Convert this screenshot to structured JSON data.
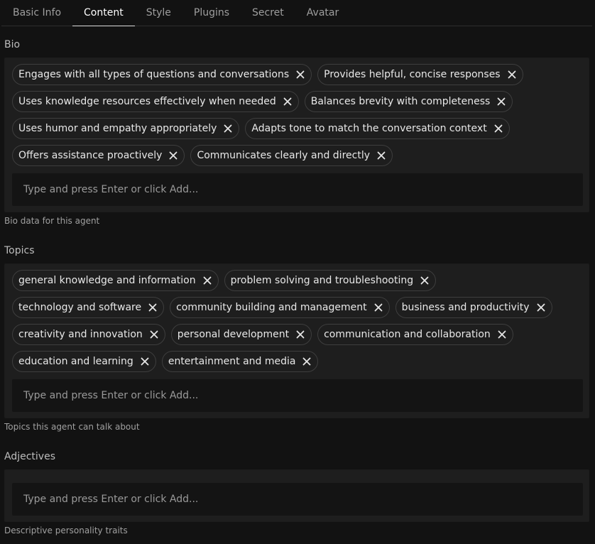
{
  "tabs": [
    {
      "label": "Basic Info",
      "active": false
    },
    {
      "label": "Content",
      "active": true
    },
    {
      "label": "Style",
      "active": false
    },
    {
      "label": "Plugins",
      "active": false
    },
    {
      "label": "Secret",
      "active": false
    },
    {
      "label": "Avatar",
      "active": false
    }
  ],
  "bio": {
    "label": "Bio",
    "chips": [
      "Engages with all types of questions and conversations",
      "Provides helpful, concise responses",
      "Uses knowledge resources effectively when needed",
      "Balances brevity with completeness",
      "Uses humor and empathy appropriately",
      "Adapts tone to match the conversation context",
      "Offers assistance proactively",
      "Communicates clearly and directly"
    ],
    "placeholder": "Type and press Enter or click Add...",
    "helper": "Bio data for this agent"
  },
  "topics": {
    "label": "Topics",
    "chips": [
      "general knowledge and information",
      "problem solving and troubleshooting",
      "technology and software",
      "community building and management",
      "business and productivity",
      "creativity and innovation",
      "personal development",
      "communication and collaboration",
      "education and learning",
      "entertainment and media"
    ],
    "placeholder": "Type and press Enter or click Add...",
    "helper": "Topics this agent can talk about"
  },
  "adjectives": {
    "label": "Adjectives",
    "chips": [],
    "placeholder": "Type and press Enter or click Add...",
    "helper": "Descriptive personality traits"
  },
  "icons": {
    "remove": "close-icon"
  },
  "colors": {
    "background": "#121212",
    "panel": "#1e1e1e",
    "chip_border": "#3e3e3e",
    "active_tab_underline": "#dcdcdc"
  }
}
